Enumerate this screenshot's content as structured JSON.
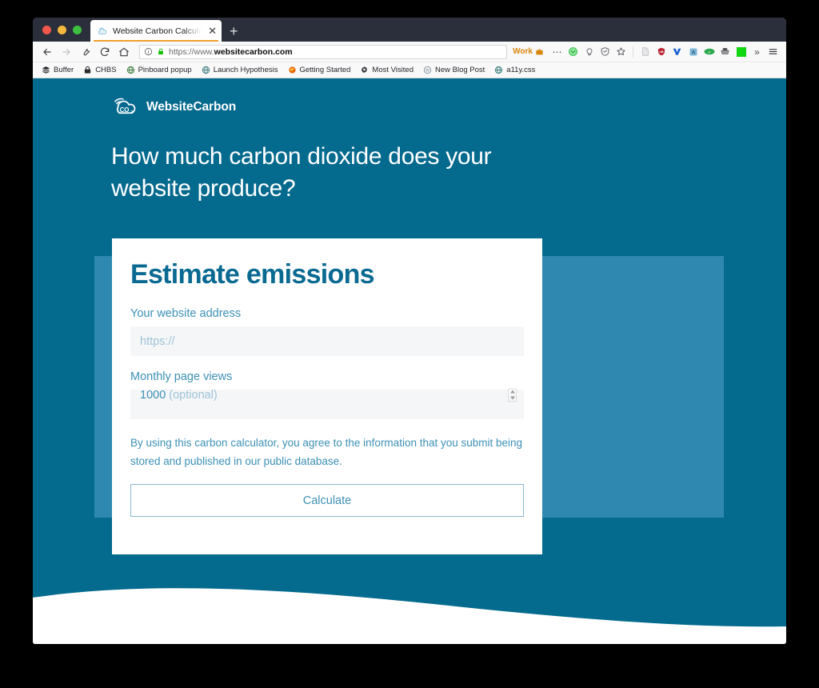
{
  "browser": {
    "traffic_lights": [
      "close",
      "minimize",
      "maximize"
    ],
    "tab": {
      "title": "Website Carbon Calculator – Ca",
      "favicon": "cloud-co2-icon",
      "close_label": "✕"
    },
    "new_tab_label": "+",
    "nav": {
      "back": "←",
      "forward": "→",
      "tools": "wrench-icon",
      "reload": "⟳",
      "home": "home-icon"
    },
    "url_bar": {
      "info_icon": "info-circle-icon",
      "lock_icon": "padlock-icon",
      "prefix": "https://www.",
      "domain": "websitecarbon.com",
      "full_url": "https://www.websitecarbon.com"
    },
    "container_badge": {
      "label": "Work",
      "icon": "briefcase-icon",
      "color": "#d9850c"
    },
    "toolbar_icons": [
      {
        "name": "overflow-dots-icon",
        "glyph": "⋯",
        "color": "#4a4a4f"
      },
      {
        "name": "pocket-icon",
        "glyph": "●",
        "color": "#3fbf52"
      },
      {
        "name": "lightbulb-icon",
        "glyph": "○",
        "color": "#6b6b70"
      },
      {
        "name": "shield-reader-icon",
        "glyph": "⬡",
        "color": "#6b6b70"
      },
      {
        "name": "bookmark-star-icon",
        "glyph": "☆",
        "color": "#5a5a5f"
      },
      {
        "name": "reader-page-icon",
        "glyph": "▤",
        "color": "#a9a9ae"
      },
      {
        "name": "ublock-origin-icon",
        "glyph": "◆",
        "color": "#b8232e"
      },
      {
        "name": "vimium-icon",
        "glyph": "▼",
        "color": "#1a5fd0"
      },
      {
        "name": "translate-icon",
        "glyph": "▣",
        "color": "#4a90c2"
      },
      {
        "name": "evernote-icon",
        "glyph": "●",
        "color": "#2ea84f"
      },
      {
        "name": "printer-icon",
        "glyph": "⚒",
        "color": "#4a4a4f"
      },
      {
        "name": "colorpicker-swatch-icon",
        "glyph": "■",
        "color": "#12d612"
      },
      {
        "name": "overflow-chevrons-icon",
        "glyph": "»",
        "color": "#4a4a4f"
      },
      {
        "name": "hamburger-menu-icon",
        "glyph": "≡",
        "color": "#2b2b30"
      }
    ],
    "bookmarks": [
      {
        "label": "Buffer",
        "icon": "buffer-layers-icon",
        "color": "#2b2b30"
      },
      {
        "label": "CHBS",
        "icon": "padlock-icon",
        "color": "#2b2b30"
      },
      {
        "label": "Pinboard popup",
        "icon": "globe-icon",
        "color": "#3a7a3a"
      },
      {
        "label": "Launch Hypothesis",
        "icon": "globe-icon",
        "color": "#3a7a7a"
      },
      {
        "label": "Getting Started",
        "icon": "firefox-icon",
        "color": "#e8650d"
      },
      {
        "label": "Most Visited",
        "icon": "gear-icon",
        "color": "#2b2b30"
      },
      {
        "label": "New Blog Post",
        "icon": "wordpress-icon",
        "color": "#6b7a86"
      },
      {
        "label": "a11y.css",
        "icon": "globe-icon",
        "color": "#3a7a7a"
      }
    ]
  },
  "page": {
    "background_color": "#046a8e",
    "panel_color": "#2e88b0",
    "logo": {
      "icon": "cloud-co2-icon",
      "wordmark": "WebsiteCarbon"
    },
    "headline": "How much carbon dioxide does your website produce?",
    "card": {
      "heading": "Estimate emissions",
      "fields": [
        {
          "name": "website-address",
          "label": "Your website address",
          "value": "",
          "placeholder": "https://"
        },
        {
          "name": "monthly-page-views",
          "label": "Monthly page views",
          "value": "",
          "placeholder_number": "1000",
          "placeholder_optional": " (optional)",
          "stepper": "number-stepper"
        }
      ],
      "consent_text": "By using this carbon calculator, you agree to the information that you submit being stored and published in our public database.",
      "submit_label": "Calculate",
      "accent_color": "#0a6a92",
      "label_color": "#3d90b5"
    }
  }
}
